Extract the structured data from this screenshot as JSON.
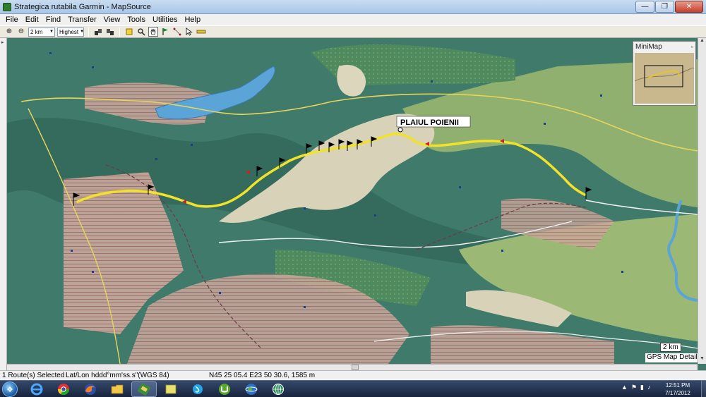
{
  "window": {
    "title": "Strategica rutabila Garmin - MapSource",
    "minimize_glyph": "—",
    "maximize_glyph": "❐",
    "close_glyph": "✕"
  },
  "menu": [
    "File",
    "Edit",
    "Find",
    "Transfer",
    "View",
    "Tools",
    "Utilities",
    "Help"
  ],
  "toolbar": {
    "zoom_level": "2 km",
    "detail_level": "Highest",
    "zoom_in_glyph": "⊕",
    "zoom_out_glyph": "⊖",
    "select_arrow": "▼"
  },
  "map": {
    "point_label": "PLAIUL POIENII",
    "colors": {
      "forest": "#3f7a6a",
      "forest_dark": "#336a5a",
      "pasture": "#8fb06e",
      "high_pasture": "#d8d2b8",
      "restricted": "#c9a89a",
      "lake": "#5aa4d8",
      "route": "#f2e22a",
      "road": "#e8d65c"
    }
  },
  "minimap": {
    "title": "MiniMap",
    "close_glyph": "▫"
  },
  "scale_label": "2 km",
  "detail_label": "GPS Map Detail",
  "status": {
    "routes": "1 Route(s) Selected",
    "format": "Lat/Lon hddd°mm'ss.s\"(WGS 84)",
    "coords": "N45 25 05.4 E23 50 30.6, 1585 m"
  },
  "taskbar": {
    "start_glyph": "❖",
    "time": "12:51 PM",
    "date": "7/17/2012"
  }
}
